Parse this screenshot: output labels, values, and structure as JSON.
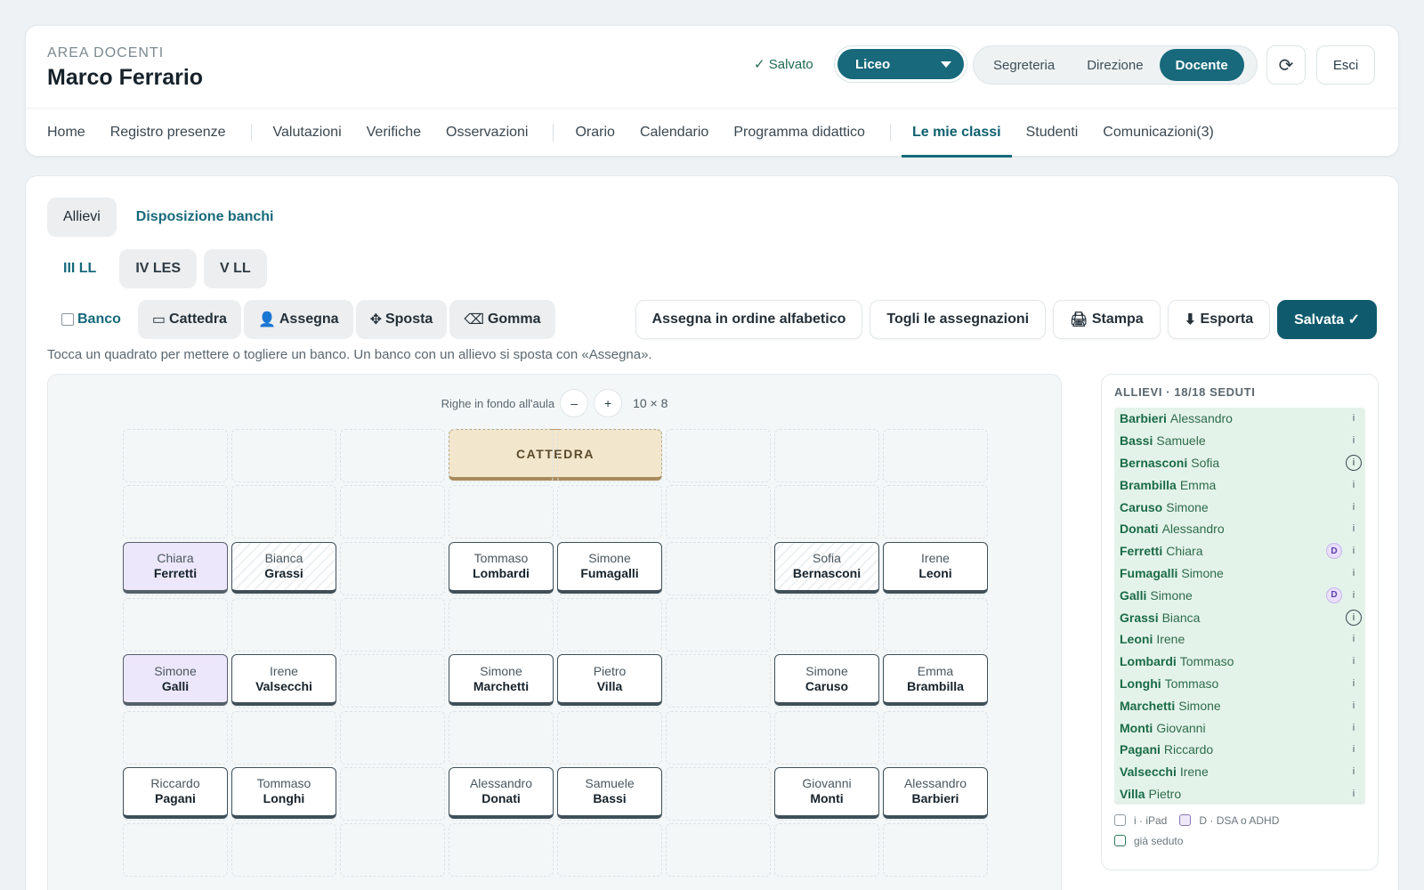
{
  "header": {
    "eyebrow": "AREA DOCENTI",
    "user_name": "Marco Ferrario",
    "saved_status": "✓ Salvato",
    "school_select": "Liceo",
    "roles": [
      "Segreteria",
      "Direzione",
      "Docente"
    ],
    "active_role": "Docente",
    "refresh_glyph": "⟳",
    "exit_label": "Esci"
  },
  "nav": {
    "items": [
      "Home",
      "Registro presenze",
      "Valutazioni",
      "Verifiche",
      "Osservazioni",
      "Orario",
      "Calendario",
      "Programma didattico",
      "Le mie classi",
      "Studenti",
      "Comunicazioni(3)"
    ],
    "active": "Le mie classi"
  },
  "tabs": [
    "Allievi",
    "Disposizione banchi"
  ],
  "active_tab": "Allievi",
  "classes": [
    "III LL",
    "IV LES",
    "V LL"
  ],
  "active_class": "III LL",
  "tools": [
    {
      "icon": "checkbox-icon",
      "label": "Banco"
    },
    {
      "icon": "rectangle-icon",
      "glyph": "▭",
      "label": "Cattedra"
    },
    {
      "icon": "person-icon",
      "glyph": "👤",
      "label": "Assegna"
    },
    {
      "icon": "move-icon",
      "glyph": "✥",
      "label": "Sposta"
    },
    {
      "icon": "eraser-icon",
      "glyph": "⌫",
      "label": "Gomma"
    }
  ],
  "active_tool": "Banco",
  "actions": {
    "alphabetical": "Assegna in ordine alfabetico",
    "clear": "Togli le assegnazioni",
    "print_glyph": "🖨",
    "print": "Stampa",
    "export_glyph": "⬇",
    "export": "Esporta",
    "saved": "Salvata ✓"
  },
  "hint": "Tocca un quadrato per mettere o togliere un banco. Un banco con un allievo si sposta con «Assegna».",
  "grid": {
    "rows_label": "Righe in fondo all'aula",
    "minus": "–",
    "plus": "+",
    "dims": "10 × 8",
    "cattedra_label": "CATTEDRA",
    "desks": [
      {
        "row": 2,
        "col": 0,
        "first": "Chiara",
        "last": "Ferretti",
        "tag": "dsa"
      },
      {
        "row": 2,
        "col": 1,
        "first": "Bianca",
        "last": "Grassi",
        "tag": "ipad"
      },
      {
        "row": 2,
        "col": 3,
        "first": "Tommaso",
        "last": "Lombardi",
        "tag": ""
      },
      {
        "row": 2,
        "col": 4,
        "first": "Simone",
        "last": "Fumagalli",
        "tag": ""
      },
      {
        "row": 2,
        "col": 6,
        "first": "Sofia",
        "last": "Bernasconi",
        "tag": "ipad"
      },
      {
        "row": 2,
        "col": 7,
        "first": "Irene",
        "last": "Leoni",
        "tag": ""
      },
      {
        "row": 4,
        "col": 0,
        "first": "Simone",
        "last": "Galli",
        "tag": "dsa"
      },
      {
        "row": 4,
        "col": 1,
        "first": "Irene",
        "last": "Valsecchi",
        "tag": ""
      },
      {
        "row": 4,
        "col": 3,
        "first": "Simone",
        "last": "Marchetti",
        "tag": ""
      },
      {
        "row": 4,
        "col": 4,
        "first": "Pietro",
        "last": "Villa",
        "tag": ""
      },
      {
        "row": 4,
        "col": 6,
        "first": "Simone",
        "last": "Caruso",
        "tag": ""
      },
      {
        "row": 4,
        "col": 7,
        "first": "Emma",
        "last": "Brambilla",
        "tag": ""
      },
      {
        "row": 6,
        "col": 0,
        "first": "Riccardo",
        "last": "Pagani",
        "tag": ""
      },
      {
        "row": 6,
        "col": 1,
        "first": "Tommaso",
        "last": "Longhi",
        "tag": ""
      },
      {
        "row": 6,
        "col": 3,
        "first": "Alessandro",
        "last": "Donati",
        "tag": ""
      },
      {
        "row": 6,
        "col": 4,
        "first": "Samuele",
        "last": "Bassi",
        "tag": ""
      },
      {
        "row": 6,
        "col": 6,
        "first": "Giovanni",
        "last": "Monti",
        "tag": ""
      },
      {
        "row": 6,
        "col": 7,
        "first": "Alessandro",
        "last": "Barbieri",
        "tag": ""
      }
    ]
  },
  "sidebar": {
    "title": "ALLIEVI · 18/18 SEDUTI",
    "students": [
      {
        "last": "Barbieri",
        "first": "Alessandro",
        "dsa": false,
        "ipad": false
      },
      {
        "last": "Bassi",
        "first": "Samuele",
        "dsa": false,
        "ipad": false
      },
      {
        "last": "Bernasconi",
        "first": "Sofia",
        "dsa": false,
        "ipad": true
      },
      {
        "last": "Brambilla",
        "first": "Emma",
        "dsa": false,
        "ipad": false
      },
      {
        "last": "Caruso",
        "first": "Simone",
        "dsa": false,
        "ipad": false
      },
      {
        "last": "Donati",
        "first": "Alessandro",
        "dsa": false,
        "ipad": false
      },
      {
        "last": "Ferretti",
        "first": "Chiara",
        "dsa": true,
        "ipad": false
      },
      {
        "last": "Fumagalli",
        "first": "Simone",
        "dsa": false,
        "ipad": false
      },
      {
        "last": "Galli",
        "first": "Simone",
        "dsa": true,
        "ipad": false
      },
      {
        "last": "Grassi",
        "first": "Bianca",
        "dsa": false,
        "ipad": true
      },
      {
        "last": "Leoni",
        "first": "Irene",
        "dsa": false,
        "ipad": false
      },
      {
        "last": "Lombardi",
        "first": "Tommaso",
        "dsa": false,
        "ipad": false
      },
      {
        "last": "Longhi",
        "first": "Tommaso",
        "dsa": false,
        "ipad": false
      },
      {
        "last": "Marchetti",
        "first": "Simone",
        "dsa": false,
        "ipad": false
      },
      {
        "last": "Monti",
        "first": "Giovanni",
        "dsa": false,
        "ipad": false
      },
      {
        "last": "Pagani",
        "first": "Riccardo",
        "dsa": false,
        "ipad": false
      },
      {
        "last": "Valsecchi",
        "first": "Irene",
        "dsa": false,
        "ipad": false
      },
      {
        "last": "Villa",
        "first": "Pietro",
        "dsa": false,
        "ipad": false
      }
    ],
    "dsa_badge": "D",
    "info_glyph": "i",
    "legend": {
      "ipad": "i · iPad",
      "dsa": "D · DSA o ADHD",
      "seated": "già seduto"
    }
  }
}
